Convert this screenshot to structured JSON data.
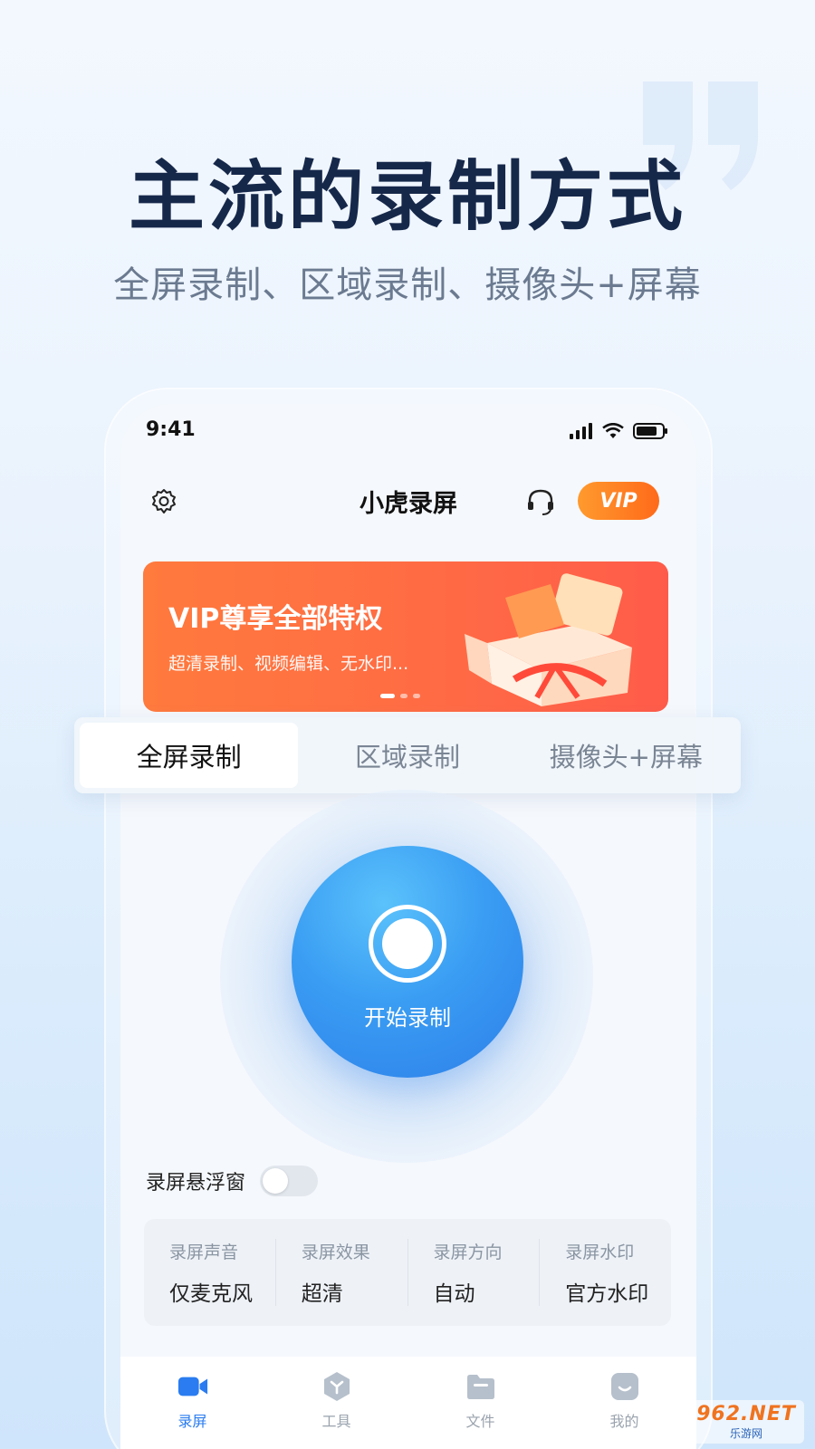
{
  "hero": {
    "title": "主流的录制方式",
    "subtitle": "全屏录制、区域录制、摄像头+屏幕"
  },
  "status_bar": {
    "time": "9:41"
  },
  "header": {
    "title": "小虎录屏",
    "vip_label": "VIP"
  },
  "banner": {
    "title": "VIP尊享全部特权",
    "subtitle": "超清录制、视频编辑、无水印..."
  },
  "mode_tabs": [
    {
      "label": "全屏录制",
      "active": true
    },
    {
      "label": "区域录制",
      "active": false
    },
    {
      "label": "摄像头+屏幕",
      "active": false
    }
  ],
  "record": {
    "label": "开始录制"
  },
  "floating_window": {
    "label": "录屏悬浮窗",
    "enabled": false
  },
  "settings": [
    {
      "label": "录屏声音",
      "value": "仅麦克风"
    },
    {
      "label": "录屏效果",
      "value": "超清"
    },
    {
      "label": "录屏方向",
      "value": "自动"
    },
    {
      "label": "录屏水印",
      "value": "官方水印"
    }
  ],
  "bottom_nav": [
    {
      "label": "录屏",
      "icon": "camera-icon",
      "active": true
    },
    {
      "label": "工具",
      "icon": "tools-icon",
      "active": false
    },
    {
      "label": "文件",
      "icon": "folder-icon",
      "active": false
    },
    {
      "label": "我的",
      "icon": "profile-icon",
      "active": false
    }
  ],
  "watermark": {
    "top": "962.NET",
    "bottom": "乐游网"
  },
  "colors": {
    "accent_blue": "#2d7fe9",
    "banner_orange": "#ff6a45",
    "title_navy": "#16284a"
  }
}
